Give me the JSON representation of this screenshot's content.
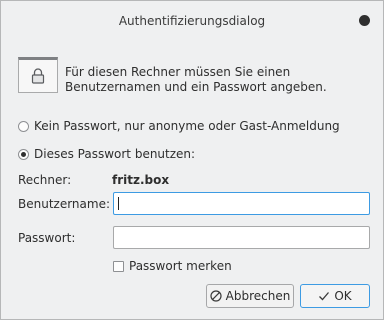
{
  "window": {
    "title": "Authentifizierungsdialog"
  },
  "prompt": {
    "line1": "Für diesen Rechner müssen Sie einen",
    "line2": "Benutzernamen und ein Passwort angeben."
  },
  "options": {
    "anonymous": "Kein Passwort, nur anonyme oder Gast-Anmeldung",
    "use_password": "Dieses Passwort benutzen:",
    "selected": "use_password"
  },
  "host": {
    "label": "Rechner:",
    "value": "fritz.box"
  },
  "username": {
    "label": "Benutzername:",
    "value": ""
  },
  "password": {
    "label": "Passwort:",
    "value": ""
  },
  "remember": {
    "label": "Passwort merken",
    "checked": false
  },
  "buttons": {
    "cancel": "Abbrechen",
    "ok": "OK"
  },
  "icons": {
    "window": "lock-icon",
    "cancel": "cancel-circle-icon",
    "ok": "checkmark-icon",
    "close": "close-dot-icon"
  }
}
